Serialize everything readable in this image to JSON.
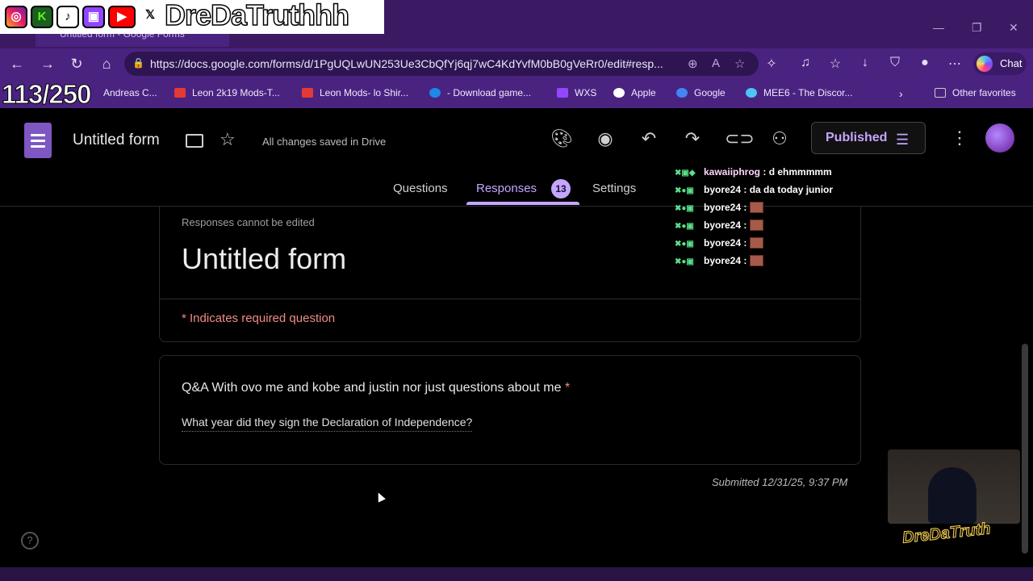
{
  "browser": {
    "active_tab_title": "Untitled form - Google Forms",
    "url": "https://docs.google.com/forms/d/1PgUQLwUN253Ue3CbQfYj6qj7wC4KdYvfM0bB0gVeRr0/edit#resp...",
    "chat_label": "Chat",
    "bookmarks": [
      {
        "label": "Andreas C...",
        "color": "#1565c0"
      },
      {
        "label": "Leon 2k19 Mods-T...",
        "color": "#e53935"
      },
      {
        "label": "Leon Mods- lo Shir...",
        "color": "#e53935"
      },
      {
        "label": "- Download game...",
        "color": "#1e88e5"
      },
      {
        "label": "WXS",
        "color": "#9146ff"
      },
      {
        "label": "Apple",
        "color": "#ffffff"
      },
      {
        "label": "Google",
        "color": "#4285f4"
      },
      {
        "label": "MEE6 - The Discor...",
        "color": "#4fc3f7"
      },
      {
        "label": "Other favorites",
        "color": "#cccccc"
      }
    ]
  },
  "forms": {
    "doc_title": "Untitled form",
    "save_status": "All changes saved in Drive",
    "published_label": "Published",
    "tabs": {
      "questions": "Questions",
      "responses": "Responses",
      "responses_count": "13",
      "settings": "Settings"
    },
    "accent": "#c5a6ff"
  },
  "response": {
    "edit_note": "Responses cannot be edited",
    "form_title": "Untitled form",
    "required_note": "* Indicates required question",
    "question": "Q&A With ovo me and kobe and justin nor just questions about me",
    "required_mark": "*",
    "answer": "What year did they sign the Declaration of Independence?",
    "submitted": "Submitted 12/31/25, 9:37 PM"
  },
  "stream": {
    "streamer_name": "DreDaTruthhh",
    "follower_goal": "113/250",
    "socials": [
      "instagram-icon",
      "kick-icon",
      "tiktok-icon",
      "twitch-icon",
      "youtube-icon",
      "x-icon"
    ],
    "chat": [
      {
        "user": "kawaiiphrog",
        "message": "d ehmmmmm"
      },
      {
        "user": "byore24",
        "message": "da da today junior"
      },
      {
        "user": "byore24",
        "message": ""
      },
      {
        "user": "byore24",
        "message": ""
      },
      {
        "user": "byore24",
        "message": ""
      },
      {
        "user": "byore24",
        "message": ""
      }
    ]
  }
}
